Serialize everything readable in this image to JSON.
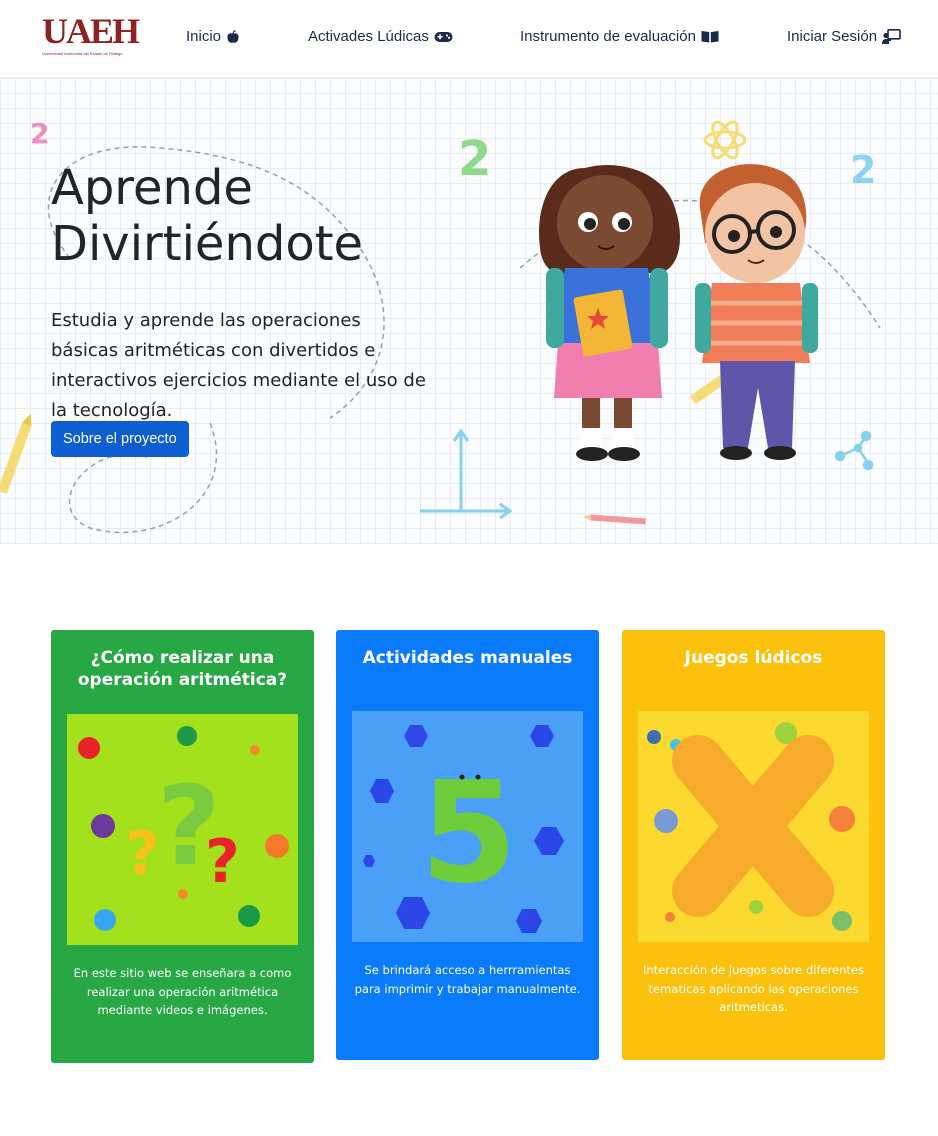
{
  "logo": {
    "text": "UAEH",
    "subtitle": "Universidad Autónoma del Estado de Hidalgo"
  },
  "nav": {
    "items": [
      {
        "label": "Inicio",
        "icon": "apple-icon"
      },
      {
        "label": "Activades Lúdicas",
        "icon": "gamepad-icon"
      },
      {
        "label": "Instrumento de evaluación",
        "icon": "book-icon"
      },
      {
        "label": "Iniciar Sesión",
        "icon": "chalkboard-teacher-icon"
      }
    ]
  },
  "hero": {
    "title_line1": "Aprende",
    "title_line2": "Divirtiéndote",
    "description": "Estudia y aprende las operaciones básicas aritméticas con divertidos e interactivos ejercicios mediante el uso de la tecnología.",
    "button_label": "Sobre el proyecto"
  },
  "cards": [
    {
      "title": "¿Cómo realizar una operación aritmética?",
      "text": "En este sitio web se enseñara a como realizar una operación aritmética mediante videos e imágenes.",
      "color": "#28a745"
    },
    {
      "title": "Actividades manuales",
      "text": "Se brindará acceso a herrramientas para imprimir y trabajar manualmente.",
      "color": "#0a7bfa"
    },
    {
      "title": "Juegos lúdicos",
      "text": "Interacción de juegos sobre diferentes tematicas aplicando las operaciones aritmeticas.",
      "color": "#fbc10d"
    }
  ],
  "colors": {
    "primary_button": "#0d5fd1",
    "nav_text": "#1a2a4a",
    "logo": "#8b2323"
  }
}
